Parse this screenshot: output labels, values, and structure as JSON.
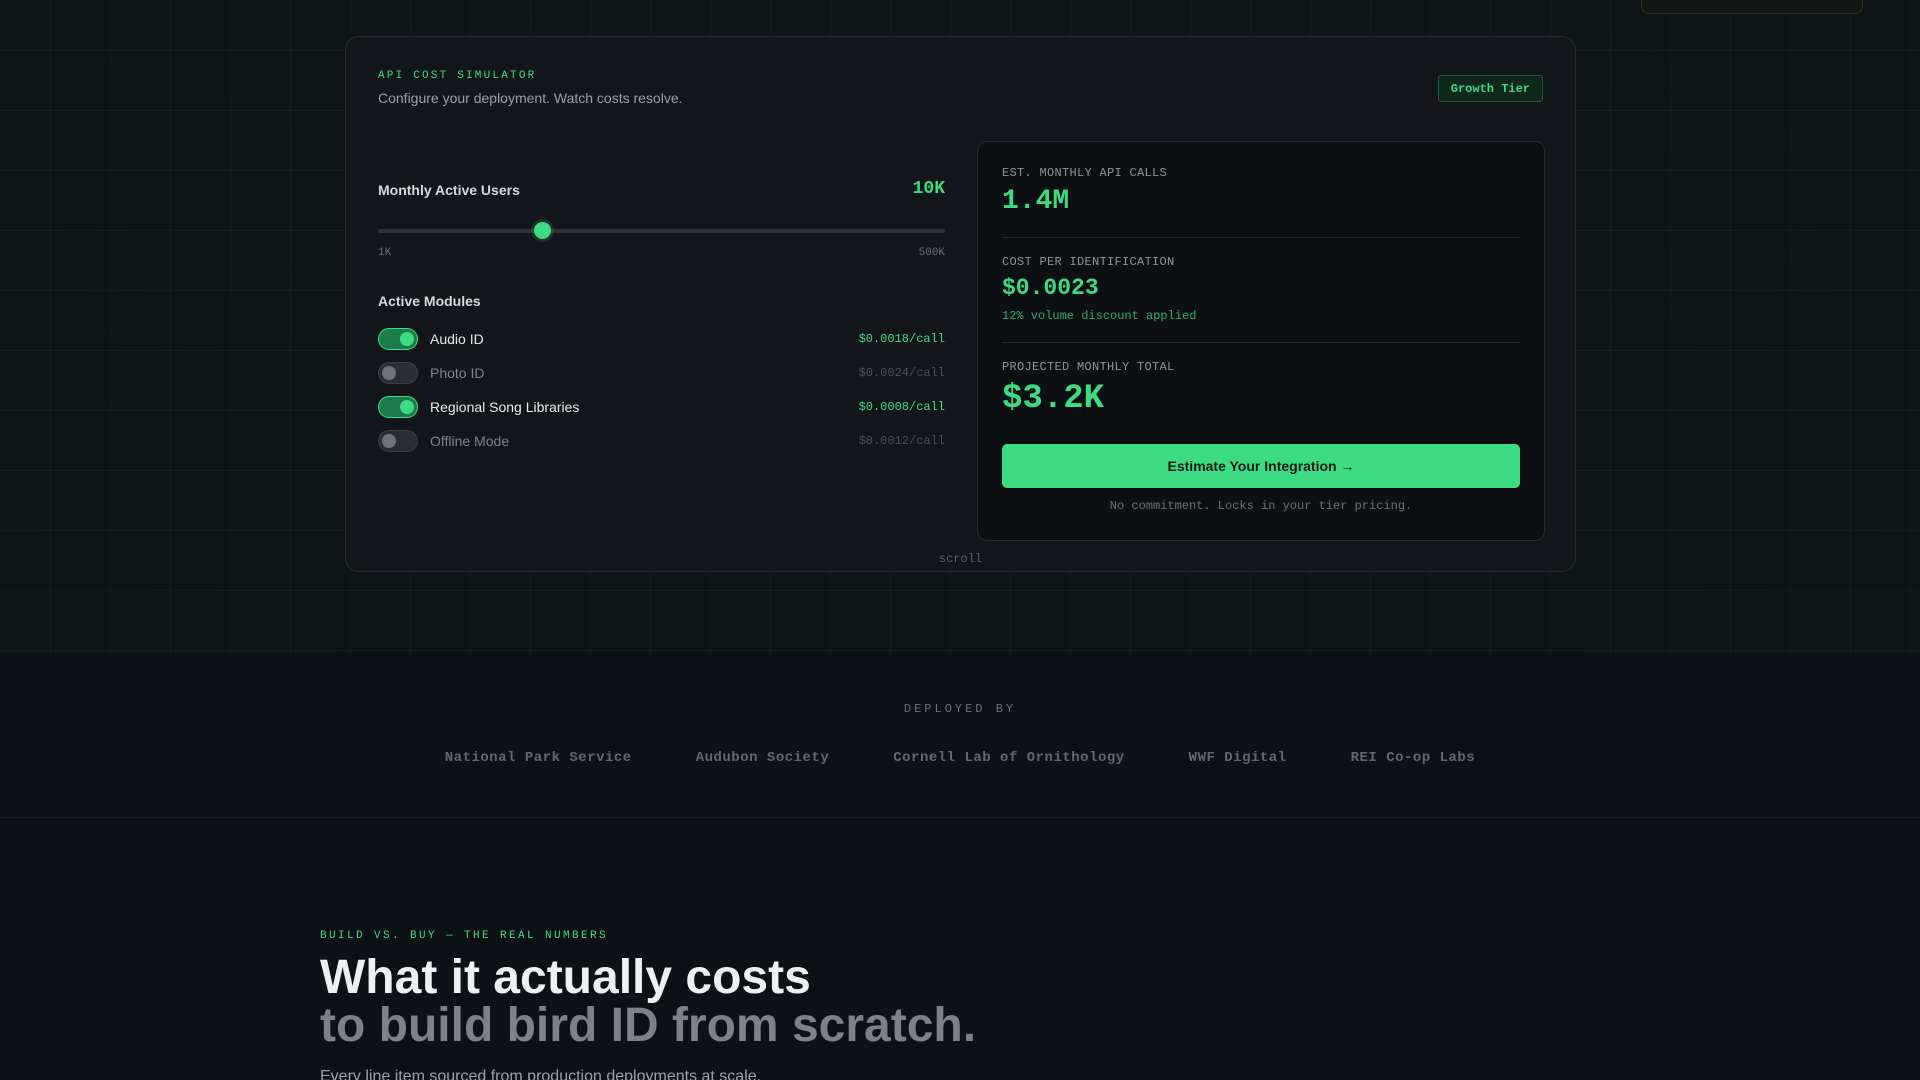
{
  "simulator": {
    "eyebrow": "API COST SIMULATOR",
    "subtitle": "Configure your deployment. Watch costs resolve.",
    "tier_badge": "Growth Tier",
    "mau": {
      "label": "Monthly Active Users",
      "value": "10K",
      "min_label": "1K",
      "max_label": "500K",
      "slider_position": 0.29
    },
    "modules_label": "Active Modules",
    "modules": [
      {
        "name": "Audio ID",
        "price": "$0.0018/call",
        "enabled": true
      },
      {
        "name": "Photo ID",
        "price": "$0.0024/call",
        "enabled": false
      },
      {
        "name": "Regional Song Libraries",
        "price": "$0.0008/call",
        "enabled": true
      },
      {
        "name": "Offline Mode",
        "price": "$0.0012/call",
        "enabled": false
      }
    ],
    "results": {
      "api_calls_label": "EST. MONTHLY API CALLS",
      "api_calls_value": "1.4M",
      "cost_label": "COST PER IDENTIFICATION",
      "cost_value": "$0.0023",
      "discount_note": "12% volume discount applied",
      "total_label": "PROJECTED MONTHLY TOTAL",
      "total_value": "$3.2K",
      "cta_label": "Estimate Your Integration →",
      "cta_note": "No commitment. Locks in your tier pricing."
    },
    "scroll_hint": "scroll"
  },
  "deployed_by": {
    "label": "DEPLOYED BY",
    "logos": [
      "National Park Service",
      "Audubon Society",
      "Cornell Lab of Ornithology",
      "WWF Digital",
      "REI Co-op Labs"
    ]
  },
  "build_vs_buy": {
    "eyebrow": "BUILD VS. BUY — THE REAL NUMBERS",
    "heading_line1": "What it actually costs",
    "heading_line2": "to build bird ID from scratch.",
    "body": "Every line item sourced from production deployments at scale."
  },
  "colors": {
    "accent": "#3ddc84",
    "background": "#0d1014",
    "card": "#121519"
  }
}
